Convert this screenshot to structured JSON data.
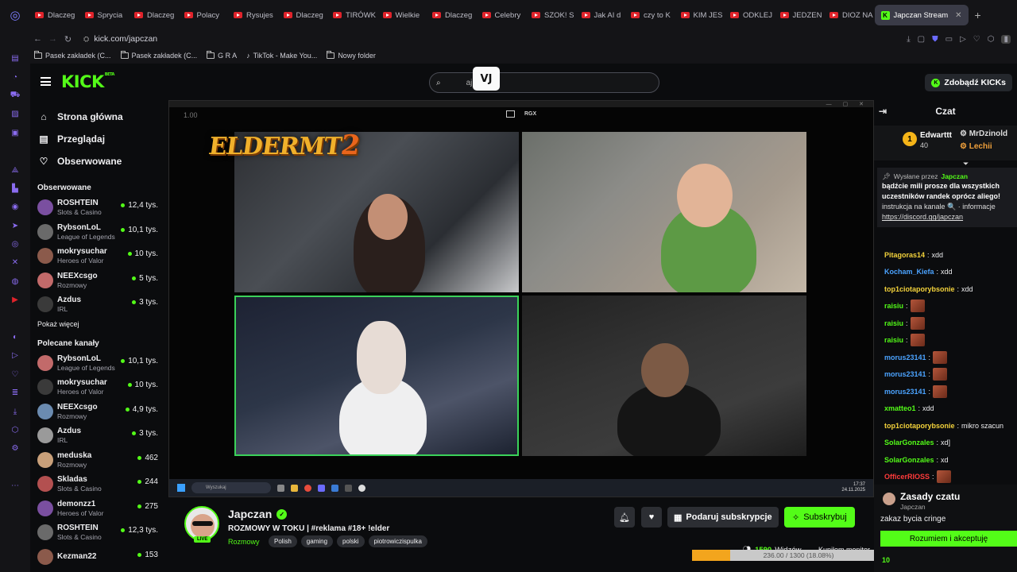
{
  "browser": {
    "tabs": [
      {
        "label": "Dlaczeg",
        "active": false
      },
      {
        "label": "Sprycia",
        "active": false
      },
      {
        "label": "Dlaczeg",
        "active": false
      },
      {
        "label": "Polacy ",
        "active": false
      },
      {
        "label": "Rysujes",
        "active": false
      },
      {
        "label": "Dlaczeg",
        "active": false
      },
      {
        "label": "TIRÓWK",
        "active": false
      },
      {
        "label": "Wielkie ",
        "active": false
      },
      {
        "label": "Dlaczeg",
        "active": false
      },
      {
        "label": "Celebry",
        "active": false
      },
      {
        "label": "SZOK! S",
        "active": false
      },
      {
        "label": "Jak AI d",
        "active": false
      },
      {
        "label": "czy to K",
        "active": false
      },
      {
        "label": "KIM JES",
        "active": false
      },
      {
        "label": "ODKLEJ",
        "active": false
      },
      {
        "label": "JEDZEN",
        "active": false
      },
      {
        "label": "DIOZ NA",
        "active": false
      }
    ],
    "active_tab_label": "Japczan Stream",
    "url": "kick.com/japczan",
    "bookmarks": [
      {
        "label": "Pasek zakładek (C...",
        "icon": "folder-icon"
      },
      {
        "label": "Pasek zakładek (C...",
        "icon": "folder-icon"
      },
      {
        "label": "G R A",
        "icon": "folder-icon"
      },
      {
        "label": "TikTok - Make You...",
        "icon": "tiktok-icon"
      },
      {
        "label": "Nowy folder",
        "icon": "folder-icon"
      }
    ]
  },
  "header": {
    "logo": "KICK",
    "logo_beta": "BETA",
    "search_text": "aj",
    "overlay_logo": "VJ",
    "get_kicks": "Zdobądź KICKs"
  },
  "sidebar": {
    "nav": [
      {
        "label": "Strona główna",
        "icon": "home-icon"
      },
      {
        "label": "Przeglądaj",
        "icon": "browse-icon"
      },
      {
        "label": "Obserwowane",
        "icon": "heart-icon"
      }
    ],
    "followed_title": "Obserwowane",
    "followed": [
      {
        "name": "ROSHTEIN",
        "category": "Slots & Casino",
        "viewers": "12,4 tys."
      },
      {
        "name": "RybsonLoL",
        "category": "League of Legends",
        "viewers": "10,1 tys."
      },
      {
        "name": "mokrysuchar",
        "category": "Heroes of Valor",
        "viewers": "10 tys."
      },
      {
        "name": "NEEXcsgo",
        "category": "Rozmowy",
        "viewers": "5 tys."
      },
      {
        "name": "Azdus",
        "category": "IRL",
        "viewers": "3 tys."
      }
    ],
    "show_more": "Pokaż więcej",
    "recommended_title": "Polecane kanały",
    "recommended": [
      {
        "name": "RybsonLoL",
        "category": "League of Legends",
        "viewers": "10,1 tys."
      },
      {
        "name": "mokrysuchar",
        "category": "Heroes of Valor",
        "viewers": "10 tys."
      },
      {
        "name": "NEEXcsgo",
        "category": "Rozmowy",
        "viewers": "4,9 tys."
      },
      {
        "name": "Azdus",
        "category": "IRL",
        "viewers": "3 tys."
      },
      {
        "name": "meduska",
        "category": "Rozmowy",
        "viewers": "462"
      },
      {
        "name": "Skladas",
        "category": "Slots & Casino",
        "viewers": "244"
      },
      {
        "name": "demonzz1",
        "category": "Heroes of Valor",
        "viewers": "275"
      },
      {
        "name": "ROSHTEIN",
        "category": "Slots & Casino",
        "viewers": "12,3 tys."
      },
      {
        "name": "Kezman22",
        "category": "",
        "viewers": "153"
      }
    ]
  },
  "player": {
    "zoom": "1.00",
    "rgx": "RGX",
    "game_logo": "ELDERMT",
    "game_logo_num": "2",
    "taskbar_search": "Wyszukaj",
    "clock_time": "17:37",
    "clock_date": "24.11.2025"
  },
  "stream": {
    "streamer": "Japczan",
    "live_badge": "LIVE",
    "title": "ROZMOWY W TOKU  | #reklama #18+ !elder",
    "category": "Rozmowy",
    "tags": [
      "Polish",
      "gaming",
      "polski",
      "piotrowiczispulka"
    ],
    "gift_label": "Podaruj subskrypcje",
    "subscribe_label": "Subskrybuj",
    "viewers_count": "1590",
    "viewers_label": "Widzów",
    "monitor_text": "Kupiłem monitor",
    "goal_text": "236.00 / 1300 (18.08%)",
    "goal_fraction": 0.1808
  },
  "chat": {
    "title": "Czat",
    "leaderboard": {
      "rank": "1",
      "top_name": "Edwarttt",
      "top_count": "40",
      "second": "MrDzinold",
      "third": "Lechii"
    },
    "pinned": {
      "by_label": "Wysłane przez",
      "by_name": "Japczan",
      "message": "bądźcie mili prosze dla wszystkich uczestników randek oprócz aliego!",
      "info": "instrukcja na kanale 🔍 · informacje",
      "link": "https://discord.gg/japczan"
    },
    "messages": [
      {
        "user": "Pitagoras14",
        "color": "#f3d23b",
        "text": "xdd",
        "emote": false
      },
      {
        "user": "Kocham_Kiefa",
        "color": "#4ba3ff",
        "text": "xdd",
        "emote": false
      },
      {
        "user": "top1ciotaporybsonie",
        "color": "#f3d23b",
        "text": "xdd",
        "emote": false
      },
      {
        "user": "raisiu",
        "color": "#53fc18",
        "text": "",
        "emote": true
      },
      {
        "user": "raisiu",
        "color": "#53fc18",
        "text": "",
        "emote": true
      },
      {
        "user": "raisiu",
        "color": "#53fc18",
        "text": "",
        "emote": true
      },
      {
        "user": "morus23141",
        "color": "#4ba3ff",
        "text": "",
        "emote": true
      },
      {
        "user": "morus23141",
        "color": "#4ba3ff",
        "text": "",
        "emote": true
      },
      {
        "user": "morus23141",
        "color": "#4ba3ff",
        "text": "",
        "emote": true
      },
      {
        "user": "xmatteo1",
        "color": "#53fc18",
        "text": "xdd",
        "emote": false
      },
      {
        "user": "top1ciotaporybsonie",
        "color": "#f3d23b",
        "text": "mikro szacun",
        "emote": false
      },
      {
        "user": "SolarGonzales",
        "color": "#53fc18",
        "text": "xd]",
        "emote": false
      },
      {
        "user": "SolarGonzales",
        "color": "#53fc18",
        "text": "xd",
        "emote": false
      },
      {
        "user": "OfficerRIOSS",
        "color": "#ff3b3b",
        "text": "",
        "emote": true
      }
    ],
    "rules_title": "Zasady czatu",
    "rules_sub": "Japczan",
    "rules_text": "zakaz bycia cringe",
    "accept_label": "Rozumiem i akceptuję",
    "bottom_count": "10"
  },
  "colors": {
    "kick_green": "#53fc18",
    "background": "#0b0c0e",
    "goal_orange": "#f3a51d"
  }
}
